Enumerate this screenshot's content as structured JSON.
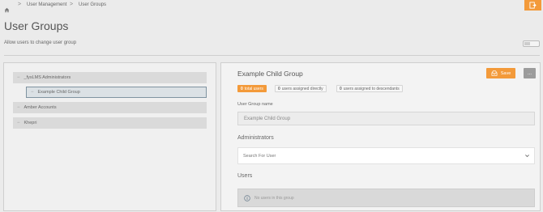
{
  "breadcrumb": {
    "home_icon": "home-icon",
    "items": [
      "User Management",
      "User Groups"
    ],
    "separator": ">"
  },
  "header": {
    "exit_icon": "exit-icon",
    "title": "User Groups",
    "allow_change_label": "Allow users to change user group",
    "allow_change_enabled": false
  },
  "tree": {
    "nodes": [
      {
        "label": "_fysLMS Administrators",
        "prefix": "−"
      },
      {
        "label": "Example Child Group",
        "prefix": "−"
      },
      {
        "label": "Amber Accounts",
        "prefix": "−"
      },
      {
        "label": "Khepri",
        "prefix": "−"
      }
    ]
  },
  "detail": {
    "title": "Example Child Group",
    "save_label": "Save",
    "more_label": "...",
    "stats": {
      "total_count": "0",
      "total_label": "total users",
      "direct_count": "0",
      "direct_label": "users assigned directly",
      "descendants_count": "0",
      "descendants_label": "users assigned to descendants"
    },
    "name_label": "User Group name",
    "name_value": "Example Child Group",
    "admins_heading": "Administrators",
    "admins_search_placeholder": "Search For User",
    "users_heading": "Users",
    "users_empty_text": "No users in this group"
  },
  "colors": {
    "accent": "#f39a3a",
    "selected_border": "#7f93a0",
    "background": "#ebebeb"
  }
}
